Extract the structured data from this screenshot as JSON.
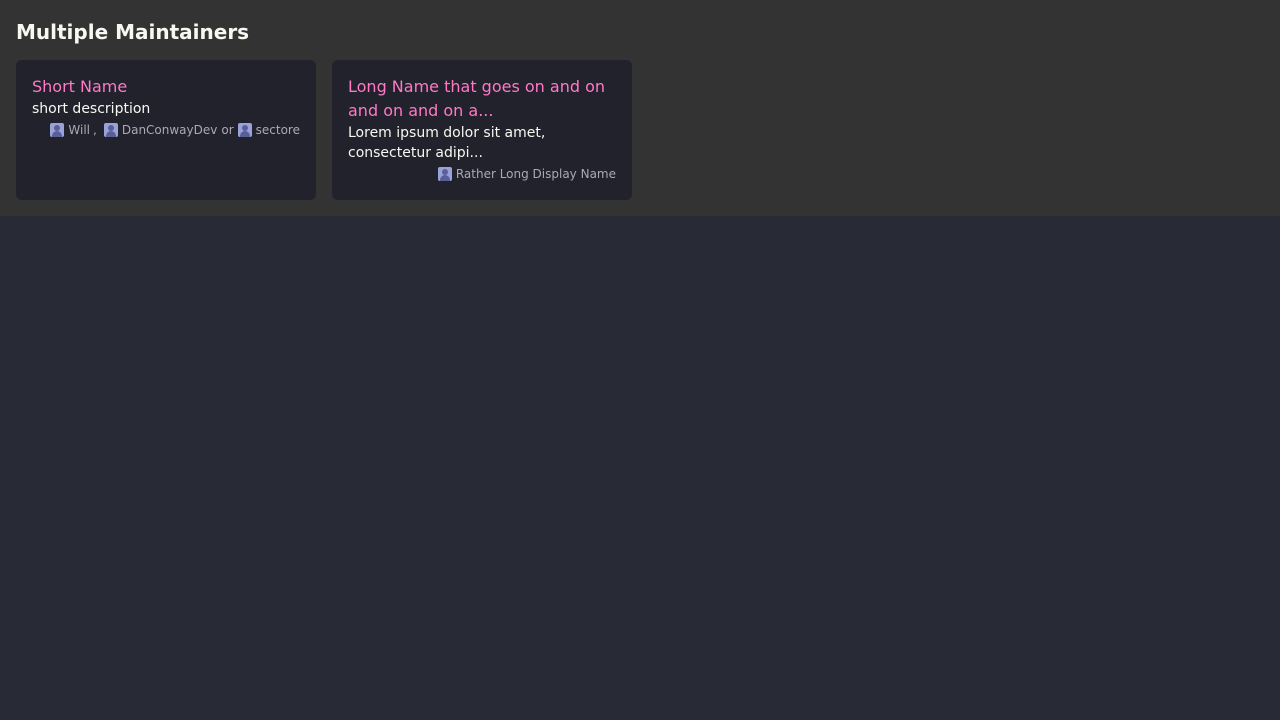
{
  "section": {
    "title": "Multiple Maintainers"
  },
  "cards": [
    {
      "title": "Short Name",
      "description": "short description",
      "maintainers": [
        "Will",
        "DanConwayDev",
        "sectore"
      ],
      "separators": [
        ",",
        "or"
      ]
    },
    {
      "title": "Long Name that goes on and on and on and on a...",
      "description": "Lorem ipsum dolor sit amet, consectetur adipi...",
      "maintainers": [
        "Rather Long Display Name"
      ]
    }
  ],
  "colors": {
    "background": "#282a36",
    "section_background": "#333333",
    "card_background": "#21222c",
    "title_accent": "#ff79c6",
    "text": "#f8f8f2",
    "muted": "#a9a9b8"
  },
  "icons": {
    "maintainer_avatar": "user-avatar-icon"
  }
}
